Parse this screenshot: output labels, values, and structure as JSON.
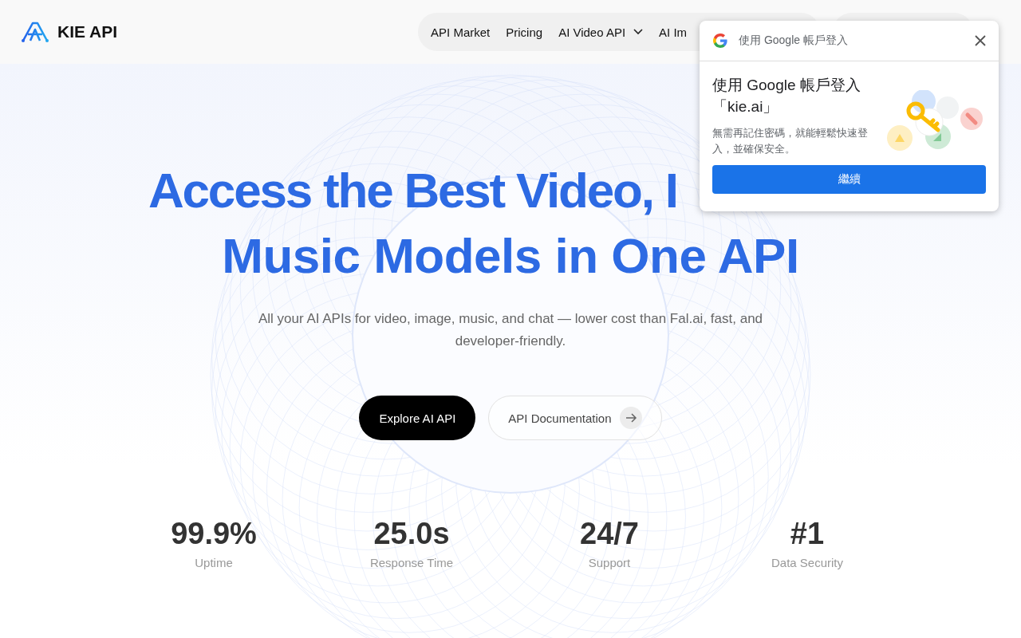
{
  "brand": {
    "name": "KIE API"
  },
  "nav": {
    "items": [
      {
        "label": "API Market",
        "dropdown": false
      },
      {
        "label": "Pricing",
        "dropdown": false
      },
      {
        "label": "AI Video API",
        "dropdown": true
      },
      {
        "label": "AI Im",
        "dropdown": false
      }
    ]
  },
  "hero": {
    "headline": [
      "Access the Best Video, I",
      "Music Models in One API"
    ],
    "subtitle": "All your AI APIs for video, image, music, and chat — lower cost than Fal.ai, fast, and developer-friendly.",
    "buttons": [
      {
        "label": "Explore AI API",
        "kind": "primary"
      },
      {
        "label": "API Documentation",
        "kind": "secondary"
      }
    ]
  },
  "stats": [
    {
      "value": "99.9%",
      "label": "Uptime"
    },
    {
      "value": "25.0s",
      "label": "Response Time"
    },
    {
      "value": "24/7",
      "label": "Support"
    },
    {
      "value": "#1",
      "label": "Data Security"
    }
  ],
  "popup": {
    "header": "使用 Google 帳戶登入",
    "title": "使用 Google 帳戶登入「kie.ai」",
    "text": "無需再記住密碼，就能輕鬆快速登入，並確保安全。",
    "button": "繼續"
  }
}
